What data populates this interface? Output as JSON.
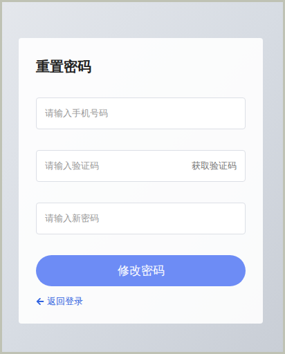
{
  "title": "重置密码",
  "fields": [
    {
      "kind": "plain",
      "placeholder": "请输入手机号码"
    },
    {
      "kind": "with-action",
      "placeholder": "请输入验证码",
      "action": "获取验证码"
    },
    {
      "kind": "plain",
      "placeholder": "请输入新密码"
    }
  ],
  "submit": "修改密码",
  "back_link": "返回登录"
}
